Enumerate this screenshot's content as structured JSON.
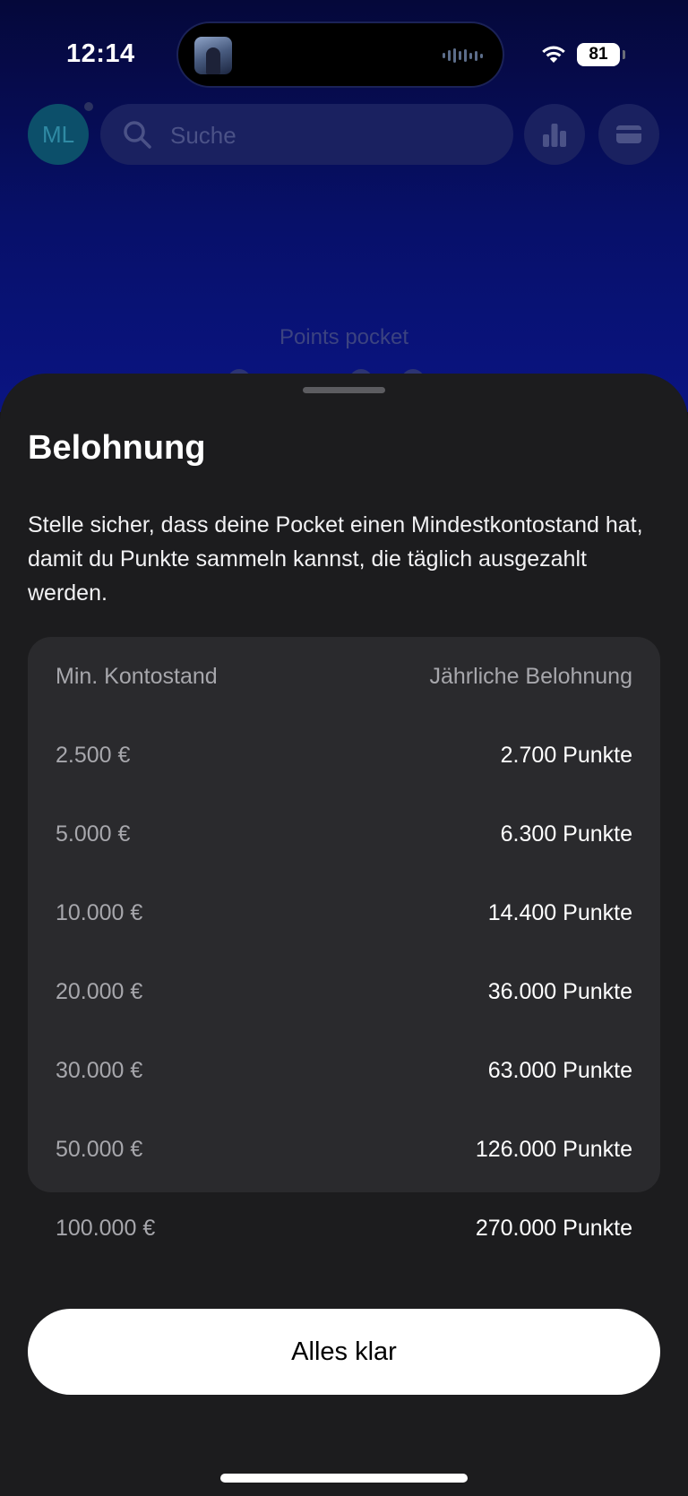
{
  "status_bar": {
    "time": "12:14",
    "battery": "81",
    "wifi_icon": "wifi-icon",
    "battery_icon": "battery-icon"
  },
  "background": {
    "avatar_initials": "ML",
    "search_placeholder": "Suche",
    "pocket_label": "Points pocket",
    "icons": [
      "search-icon",
      "bar-chart-icon",
      "card-icon"
    ]
  },
  "sheet": {
    "title": "Belohnung",
    "description": "Stelle sicher, dass deine Pocket einen Mindestkontostand hat, damit du Punkte sammeln kannst, die täglich ausgezahlt werden.",
    "table": {
      "header": {
        "min_balance": "Min. Kontostand",
        "annual_reward": "Jährliche Belohnung"
      },
      "rows": [
        {
          "min_balance": "2.500 €",
          "reward": "2.700 Punkte"
        },
        {
          "min_balance": "5.000 €",
          "reward": "6.300 Punkte"
        },
        {
          "min_balance": "10.000 €",
          "reward": "14.400 Punkte"
        },
        {
          "min_balance": "20.000 €",
          "reward": "36.000 Punkte"
        },
        {
          "min_balance": "30.000 €",
          "reward": "63.000 Punkte"
        },
        {
          "min_balance": "50.000 €",
          "reward": "126.000 Punkte"
        },
        {
          "min_balance": "100.000 €",
          "reward": "270.000 Punkte"
        }
      ]
    },
    "confirm_label": "Alles klar"
  },
  "colors": {
    "sheet_background": "#1c1c1e",
    "table_background": "#2a2a2d",
    "button_background": "#ffffff",
    "app_background": "#07106a"
  }
}
